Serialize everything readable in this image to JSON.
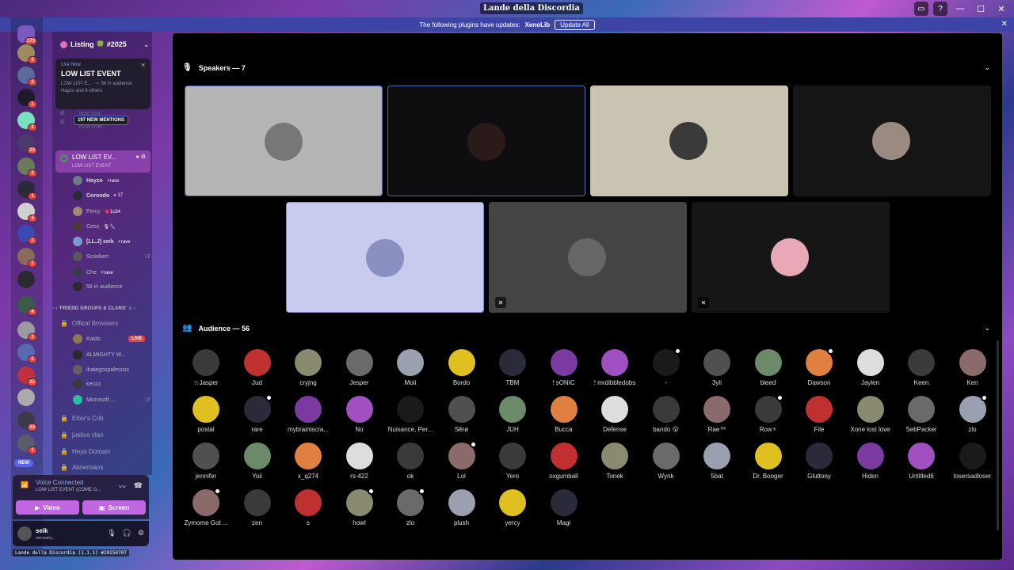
{
  "app": {
    "title": "Lande della Discordia",
    "version": "Lande della Discordia (1.1.1) #20250707"
  },
  "notice": {
    "text": "The following plugins have updates:",
    "plugin": "XenoLib",
    "button": "Update All"
  },
  "rail": {
    "top_count": "173",
    "new_label": "NEW"
  },
  "guild": {
    "name": "Listing 🍀 #2025"
  },
  "live_card": {
    "live_now": "Live Now",
    "title": "LOW LIST EVENT",
    "sub": "LOW LIST E... · ✧ 56 in audience",
    "hosts": "Hayzo and 6 others"
  },
  "mentions": "197 NEW MENTIONS",
  "ghost": {
    "a": "host-usa",
    "b": "host-chat"
  },
  "active_channel": {
    "name": "LOW LIST EV...",
    "status": "LOW LIST EVENT"
  },
  "voice_members": [
    {
      "name": "Hayzo",
      "tag": "⚡rave"
    },
    {
      "name": "Corondo",
      "tag": "◕ 17"
    },
    {
      "name": "Fercy",
      "tag": "💗1c34"
    },
    {
      "name": "Ceez",
      "tag": "🎙🔧"
    },
    {
      "name": "[LL.J] seik",
      "tag": "⚡rave"
    },
    {
      "name": "Scoobert",
      "tag": ""
    },
    {
      "name": "Che",
      "tag": "⚡rave"
    },
    {
      "name": "56 in audience",
      "tag": ""
    }
  ],
  "category": "- › 'FRIEND GROUPS & CLANS' ⚔ -",
  "channels": {
    "browsers": "Offical Browsers",
    "kaido": "Kaido",
    "almighty": "ALMIGHTY W...",
    "ihate": "ihategospalmusic",
    "kenzz": "kenzz",
    "microsoft": "Microsoft ...",
    "elixir": "Elixir's Crib",
    "justice": "justice clan",
    "heyo": "Heyo Domain",
    "aknemians": "Aknemians",
    "live": "LIVE"
  },
  "voice_panel": {
    "status": "Voice Connected",
    "channel": "LOW LIST EVENT (COME G...",
    "video": "Video",
    "screen": "Screen"
  },
  "user": {
    "name": "seik",
    "status": "not every..."
  },
  "speakers": {
    "header": "Speakers — 7"
  },
  "audience": {
    "header": "Audience — 56",
    "rows": [
      [
        "☆Jasper",
        "Jud",
        "cryjng",
        "Jesper",
        "Moii",
        "Bordo",
        "TBM",
        "! sONIC",
        "! mrdibbledobs",
        "-",
        "3yli",
        "bleed",
        "Dawson",
        "Jaylen",
        "Keen",
        "Ken"
      ],
      [
        "postal",
        "rare",
        "mybrainiscra...",
        "No",
        "Nuisance, Per...",
        "Sêrø",
        "JUH",
        "Bucca",
        "Defense",
        "bando 😮",
        "Rae™",
        "Row⚡",
        "File",
        "Xone lost love",
        "SebPacker",
        "zlo"
      ],
      [
        "jennifer",
        "Yoii",
        "x_q274",
        "rs-422",
        "ok",
        "Lol",
        "Yero",
        "oxgumball",
        "Tonek",
        "Wynk",
        "5bat",
        "Dr. Booger",
        "Gluttony",
        "Hiden",
        "Untitled6",
        "losersadloser"
      ],
      [
        "Zymome Got ...",
        "zen",
        "s",
        "howl",
        "zlo",
        "plush",
        "yercy",
        "Magi"
      ]
    ]
  },
  "colors": {
    "accent": "#c066e0",
    "stage_bg": "#000000",
    "notice_bg": "#3c45a5",
    "live": "#f23f43"
  }
}
